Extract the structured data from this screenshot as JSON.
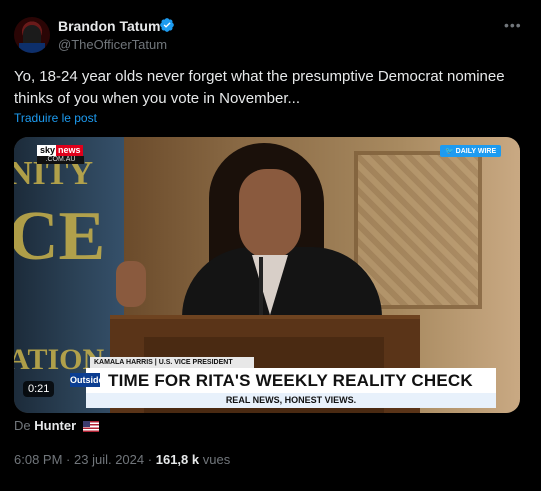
{
  "author": {
    "name": "Brandon Tatum",
    "handle": "@TheOfficerTatum",
    "verified_color": "#1d9bf0"
  },
  "tweet": {
    "text": "Yo, 18-24 year olds never forget what the presumptive Democrat nominee thinks of you when you vote in November...",
    "translate_label": "Traduire le post",
    "more_icon": "more-icon"
  },
  "video": {
    "background_left_text_top": "NITY",
    "background_left_text_mid": "CE",
    "background_left_text_bottom": "ATION",
    "network_sky": "sky",
    "network_news": "news",
    "network_domain": ".COM.AU",
    "badge": "DAILY WIRE",
    "lower_third_name": "KAMALA HARRIS | U.S. VICE PRESIDENT",
    "show_logo": "Outsiders",
    "headline": "TIME FOR RITA'S WEEKLY REALITY CHECK",
    "subline": "REAL NEWS, HONEST VIEWS.",
    "duration": "0:21"
  },
  "attribution": {
    "prefix": "De",
    "source": "Hunter",
    "flag_icon": "us-flag-icon"
  },
  "meta": {
    "time": "6:08 PM",
    "date": "23 juil. 2024",
    "views_count": "161,8 k",
    "views_label": "vues",
    "separator": "·"
  }
}
